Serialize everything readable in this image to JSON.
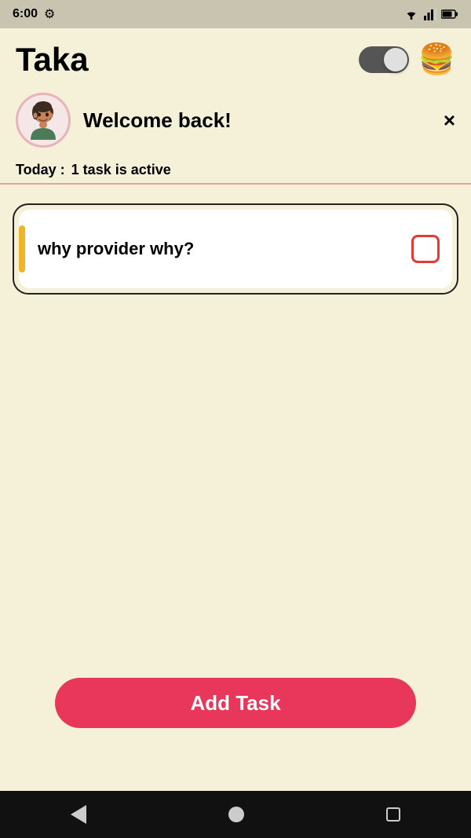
{
  "status_bar": {
    "time": "6:00",
    "wifi_icon": "wifi",
    "signal_icon": "signal",
    "battery_icon": "battery",
    "gear_icon": "gear"
  },
  "header": {
    "title": "Taka",
    "toggle_state": "on",
    "burger_emoji": "🍔"
  },
  "welcome": {
    "text": "Welcome back!",
    "close_label": "×"
  },
  "today": {
    "label": "Today :",
    "task_count_text": "1 task is active"
  },
  "tasks": [
    {
      "id": 1,
      "text": "why provider why?",
      "completed": false
    }
  ],
  "add_task_button": {
    "label": "Add Task"
  },
  "nav": {
    "back_label": "back",
    "home_label": "home",
    "recent_label": "recent"
  }
}
